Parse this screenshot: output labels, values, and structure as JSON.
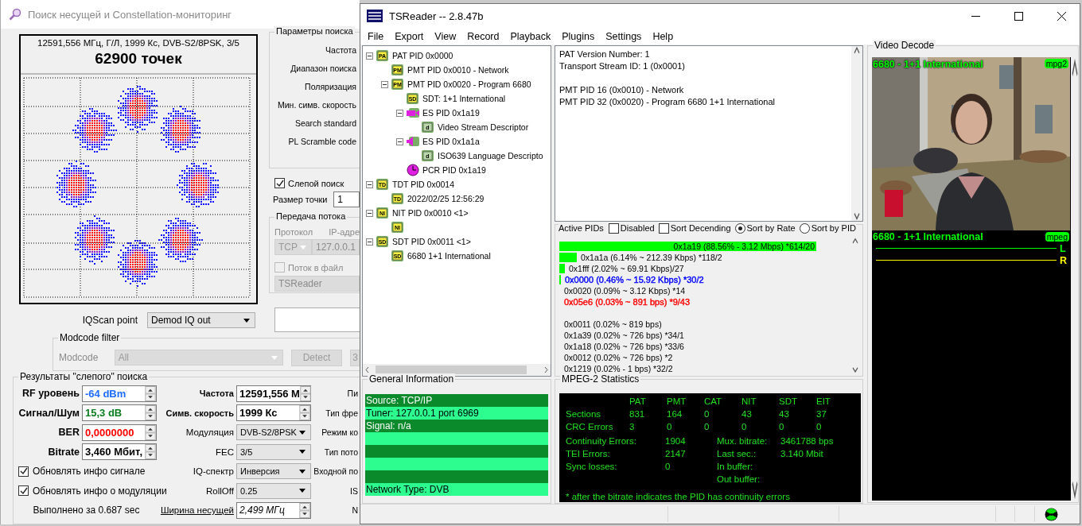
{
  "search_window": {
    "title": "Поиск несущей и Constellation-мониторинг",
    "constellation": {
      "header": "12591,556 МГц, Г/Л, 1999 Кс, DVB-S2/8PSK, 3/5",
      "points": "62900 точек"
    },
    "search_params": {
      "title": "Параметры поиска",
      "labels": [
        "Частота",
        "Диапазон поиска",
        "Поляризация",
        "Мин. симв. скорость",
        "Search standard",
        "PL Scramble code"
      ]
    },
    "blind_search": {
      "label": "Слепой поиск",
      "checked": true
    },
    "point_size": {
      "label": "Размер точки",
      "value": "1"
    },
    "stream": {
      "title": "Передача потока",
      "protocol_label": "Протокол",
      "ip_label": "IP-адре",
      "protocol": "TCP",
      "ip": "127.0.0.1",
      "to_file": {
        "label": "Поток в файл",
        "checked": false
      },
      "file": "TSReader",
      "disabled": true
    },
    "iqscan": {
      "label": "IQScan point",
      "value": "Demod IQ out"
    },
    "modcode_filter": {
      "title": "Modcode filter",
      "label": "Modcode",
      "value": "All",
      "detect": "Detect",
      "extra": "3",
      "disabled": true
    },
    "results": {
      "title": "Результаты \"слепого\" поиска",
      "signal": [
        {
          "label": "RF уровень",
          "value": "-64 dBm",
          "color": "#1e6cff"
        },
        {
          "label": "Сигнал/Шум",
          "value": "15,3 dB",
          "color": "#0a7d1e"
        },
        {
          "label": "BER",
          "value": "0,0000000",
          "color": "#ff0000"
        },
        {
          "label": "Bitrate",
          "value": "3,460 Мбит,",
          "color": "#000000"
        }
      ],
      "options": [
        {
          "label": "Обновлять инфо сигнале",
          "checked": true
        },
        {
          "label": "Обновлять инфо о модуляции",
          "checked": true
        }
      ],
      "elapsed": "Выполнено за 0.687 sec",
      "params": [
        {
          "label": "Частота",
          "value": "12591,556 М",
          "kind": "spin"
        },
        {
          "label": "Симв. скорость",
          "value": "1999 Кс",
          "kind": "spin"
        },
        {
          "label": "Модуляция",
          "value": "DVB-S2/8PSK",
          "kind": "select"
        },
        {
          "label": "FEC",
          "value": "3/5",
          "kind": "select"
        },
        {
          "label": "IQ-спектр",
          "value": "Инверсия",
          "kind": "select"
        },
        {
          "label": "RollOff",
          "value": "0.25",
          "kind": "select"
        },
        {
          "label": "Ширина несущей",
          "value": "2,499 МГц",
          "kind": "link"
        }
      ],
      "more_labels": [
        "Пи",
        "Тип фре",
        "Режим ко",
        "Тип пото",
        "Входной по",
        "IS",
        "N"
      ]
    }
  },
  "tsreader": {
    "title": "TSReader -- 2.8.47b",
    "menu": [
      "File",
      "Export",
      "View",
      "Record",
      "Playback",
      "Plugins",
      "Settings",
      "Help"
    ],
    "tree": [
      {
        "kind": "table",
        "badge": "PA",
        "label": "PAT PID 0x0000",
        "expanded": true,
        "children": [
          {
            "kind": "table",
            "badge": "PM",
            "label": "PMT PID 0x0010 - Network"
          },
          {
            "kind": "table",
            "badge": "PM",
            "label": "PMT PID 0x0020 - Program 6680",
            "expanded": true,
            "children": [
              {
                "kind": "table",
                "badge": "SD",
                "label": "SDT: 1+1 International"
              },
              {
                "kind": "video",
                "label": "ES PID 0x1a19",
                "expanded": true,
                "children": [
                  {
                    "kind": "descriptor",
                    "badge": "d",
                    "label": "Video Stream Descriptor"
                  }
                ]
              },
              {
                "kind": "audio",
                "label": "ES PID 0x1a1a",
                "expanded": true,
                "children": [
                  {
                    "kind": "descriptor",
                    "badge": "d",
                    "label": "ISO639 Language Descripto"
                  }
                ]
              },
              {
                "kind": "clock",
                "label": "PCR PID 0x1a19"
              }
            ]
          }
        ]
      },
      {
        "kind": "table",
        "badge": "TD",
        "label": "TDT PID 0x0014",
        "expanded": true,
        "children": [
          {
            "kind": "table",
            "badge": "TD",
            "label": "2022/02/25 12:56:29"
          }
        ]
      },
      {
        "kind": "table",
        "badge": "NI",
        "label": "NIT PID 0x0010 <1>",
        "expanded": true,
        "children": [
          {
            "kind": "table",
            "badge": "NI"
          }
        ]
      },
      {
        "kind": "table",
        "badge": "SD",
        "label": "SDT PID 0x0011 <1>",
        "expanded": true,
        "children": [
          {
            "kind": "table",
            "badge": "SD",
            "label": "6680 1+1 International"
          }
        ]
      }
    ],
    "info_blocks": [
      [
        "PAT Version Number: 1",
        "Transport Stream ID: 1 (0x0001)"
      ],
      [
        "PMT PID 16 (0x0010) - Network",
        "PMT PID 32 (0x0020) - Program 6680 1+1 International"
      ]
    ],
    "active_pids": {
      "title": "Active PIDs",
      "checks": [
        {
          "label": "Disabled",
          "checked": false
        },
        {
          "label": "Sort Decending",
          "checked": false
        }
      ],
      "sort": [
        {
          "label": "Sort by Rate",
          "selected": true
        },
        {
          "label": "Sort by PID",
          "selected": false
        }
      ],
      "rows": [
        {
          "text": "0x1a19 (88.56% - 3.12 Mbps) *614/20",
          "level": 0.8856
        },
        {
          "text": "0x1a1a (6.14% ~ 212.39 Kbps) *118/2",
          "level": 0.0614
        },
        {
          "text": "0x1fff (2.02% ~ 69.91 Kbps)/27",
          "level": 0.0202
        },
        {
          "text": "0x0000 (0.46% ~ 15.92 Kbps) *30/2",
          "level": 0.0046,
          "color": "#0000ff"
        },
        {
          "text": "0x0020 (0.09% ~ 3.12 Kbps) *14"
        },
        {
          "text": "0x05e6 (0.03% ~ 891 bps) *9/43",
          "color": "#ff0000"
        },
        {
          "text": "0x0011 (0.02% ~ 819 bps)",
          "gap_before": true
        },
        {
          "text": "0x1a39 (0.02% ~ 726 bps) *34/1"
        },
        {
          "text": "0x1a18 (0.02% ~ 726 bps) *33/6"
        },
        {
          "text": "0x0012 (0.02% ~ 726 bps) *2"
        },
        {
          "text": "0x1219 (0.02% - 1 bps) *32/2"
        }
      ]
    },
    "general": {
      "title": "General Information",
      "lines": [
        "Source: TCP/IP",
        "Tuner: 127.0.0.1 port 6969",
        "Signal: n/a"
      ],
      "footer": "Network Type: DVB"
    },
    "stats": {
      "title": "MPEG-2 Statistics",
      "columns": [
        "PAT",
        "PMT",
        "CAT",
        "NIT",
        "SDT",
        "EIT"
      ],
      "rows": [
        {
          "label": "Sections",
          "values": [
            "831",
            "164",
            "0",
            "43",
            "43",
            "37"
          ]
        },
        {
          "label": "CRC Errors",
          "values": [
            "3",
            "0",
            "0",
            "0",
            "0",
            "0"
          ]
        }
      ],
      "counters": [
        {
          "label": "Continuity Errors:",
          "value": "1904"
        },
        {
          "label": "TEI Errors:",
          "value": "2147"
        },
        {
          "label": "Sync losses:",
          "value": "0"
        }
      ],
      "rates": [
        {
          "label": "Mux. bitrate:",
          "value": "3461788 bps"
        },
        {
          "label": "Last sec.:",
          "value": "3.140 Mbit"
        },
        {
          "label": "In buffer:"
        },
        {
          "label": "Out buffer:"
        }
      ],
      "note": "* after the bitrate indicates the PID has continuity errors"
    },
    "video": {
      "title": "Video Decode",
      "channel": "6680 - 1+1 International",
      "video_codec": "mpg2",
      "audio_channel": "6680 - 1+1 International",
      "audio_codec": "mpeg",
      "channels": [
        {
          "label": "L",
          "color": "#00ff00"
        },
        {
          "label": "R",
          "color": "#ffff00"
        }
      ]
    }
  }
}
